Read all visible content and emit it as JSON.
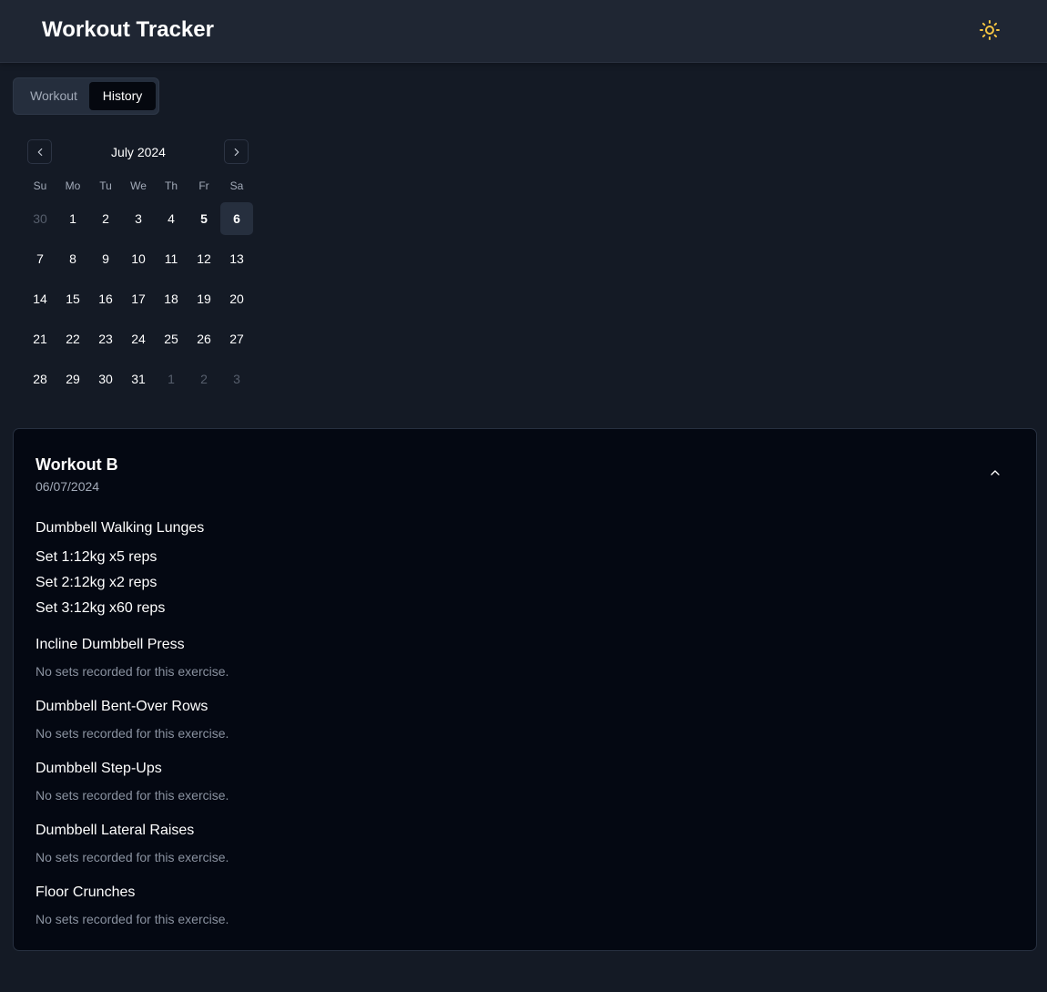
{
  "header": {
    "title": "Workout Tracker",
    "theme_icon": "sun-icon",
    "theme_icon_color": "#f5c542"
  },
  "tabs": [
    {
      "label": "Workout",
      "active": false
    },
    {
      "label": "History",
      "active": true
    }
  ],
  "calendar": {
    "month_label": "July 2024",
    "weekdays": [
      "Su",
      "Mo",
      "Tu",
      "We",
      "Th",
      "Fr",
      "Sa"
    ],
    "days": [
      {
        "label": "30",
        "outside": true
      },
      {
        "label": "1"
      },
      {
        "label": "2"
      },
      {
        "label": "3"
      },
      {
        "label": "4"
      },
      {
        "label": "5",
        "today": true
      },
      {
        "label": "6",
        "selected": true
      },
      {
        "label": "7"
      },
      {
        "label": "8"
      },
      {
        "label": "9"
      },
      {
        "label": "10"
      },
      {
        "label": "11"
      },
      {
        "label": "12"
      },
      {
        "label": "13"
      },
      {
        "label": "14"
      },
      {
        "label": "15"
      },
      {
        "label": "16"
      },
      {
        "label": "17"
      },
      {
        "label": "18"
      },
      {
        "label": "19"
      },
      {
        "label": "20"
      },
      {
        "label": "21"
      },
      {
        "label": "22"
      },
      {
        "label": "23"
      },
      {
        "label": "24"
      },
      {
        "label": "25"
      },
      {
        "label": "26"
      },
      {
        "label": "27"
      },
      {
        "label": "28"
      },
      {
        "label": "29"
      },
      {
        "label": "30"
      },
      {
        "label": "31"
      },
      {
        "label": "1",
        "outside": true
      },
      {
        "label": "2",
        "outside": true
      },
      {
        "label": "3",
        "outside": true
      }
    ]
  },
  "workout": {
    "title": "Workout B",
    "date": "06/07/2024",
    "exercises": [
      {
        "name": "Dumbbell Walking Lunges",
        "sets": [
          "Set 1:12kg x5 reps",
          "Set 2:12kg x2 reps",
          "Set 3:12kg x60 reps"
        ]
      },
      {
        "name": "Incline Dumbbell Press",
        "sets": []
      },
      {
        "name": "Dumbbell Bent-Over Rows",
        "sets": []
      },
      {
        "name": "Dumbbell Step-Ups",
        "sets": []
      },
      {
        "name": "Dumbbell Lateral Raises",
        "sets": []
      },
      {
        "name": "Floor Crunches",
        "sets": []
      }
    ],
    "no_sets_text": "No sets recorded for this exercise."
  }
}
